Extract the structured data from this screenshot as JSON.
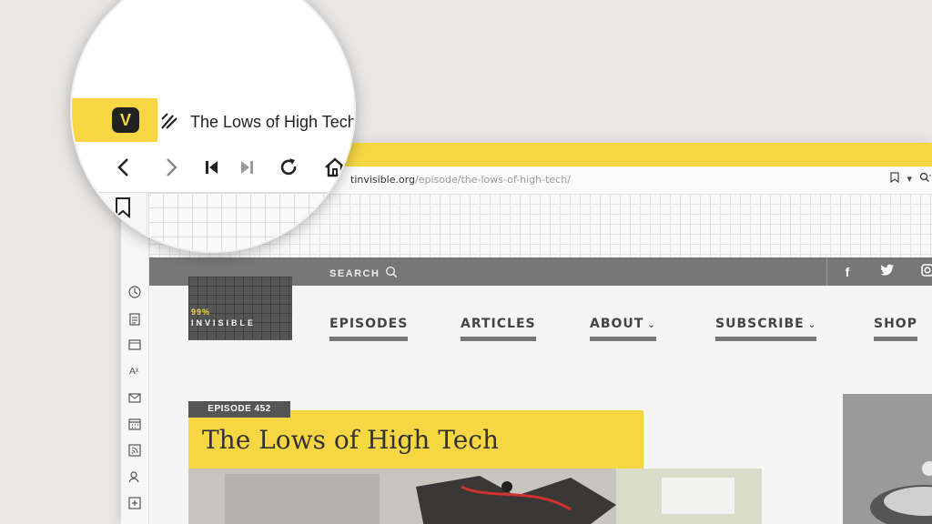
{
  "browser": {
    "url_domain": "tinvisible.org",
    "url_path": "/episode/the-lows-of-high-tech/"
  },
  "site": {
    "search_label": "SEARCH",
    "social": [
      "f",
      "t",
      "i"
    ],
    "logo_number": "99%",
    "logo_word": "INVISIBLE",
    "nav": [
      {
        "label": "EPISODES"
      },
      {
        "label": "ARTICLES"
      },
      {
        "label": "ABOUT",
        "chevron": "⌄"
      },
      {
        "label": "SUBSCRIBE",
        "chevron": "⌄"
      },
      {
        "label": "SHOP"
      }
    ],
    "episode_badge": "EPISODE 452",
    "episode_title": "The Lows of High Tech"
  },
  "magnifier": {
    "tab_title": "The Lows of High Tech",
    "vivaldi_glyph": "V"
  },
  "colors": {
    "accent_yellow": "#f6d743",
    "bar_gray": "#777777",
    "background": "#e9e7e5"
  }
}
